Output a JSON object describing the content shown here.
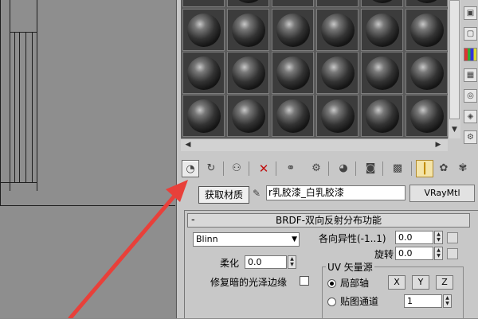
{
  "toolbar": {
    "tooltip": "获取材质",
    "icons": [
      "get-material-icon",
      "put-to-scene-icon",
      "assign-to-selection-icon",
      "delete-icon",
      "copy-material-icon",
      "make-unique-icon",
      "put-to-library-icon",
      "material-id-channel-icon",
      "show-map-icon",
      "show-end-result-icon",
      "go-to-parent-icon",
      "go-forward-icon"
    ]
  },
  "material": {
    "name": "r乳胶漆_白乳胶漆",
    "type_button": "VRayMtl"
  },
  "rollout": {
    "collapse": "-",
    "title": "BRDF-双向反射分布功能",
    "shader": "Blinn",
    "anisotropy_label": "各向异性(-1..1)",
    "anisotropy_value": "0.0",
    "rotation_label": "旋转",
    "rotation_value": "0.0",
    "soften_label": "柔化",
    "soften_value": "0.0",
    "fix_dark_edges_label": "修复暗的光泽边缘",
    "uv_group_title": "UV 矢量源",
    "local_axis_label": "局部轴",
    "map_channel_label": "贴图通道",
    "map_channel_value": "1",
    "axis_buttons": [
      "X",
      "Y",
      "Z"
    ]
  },
  "scroll": {
    "left_arrow": "◀",
    "right_arrow": "▶",
    "down_arrow": "▼"
  },
  "colors": {
    "accent_arrow": "#e8403a",
    "panel_bg": "#c8c8c8",
    "viewport_bg": "#8e8e8e"
  }
}
